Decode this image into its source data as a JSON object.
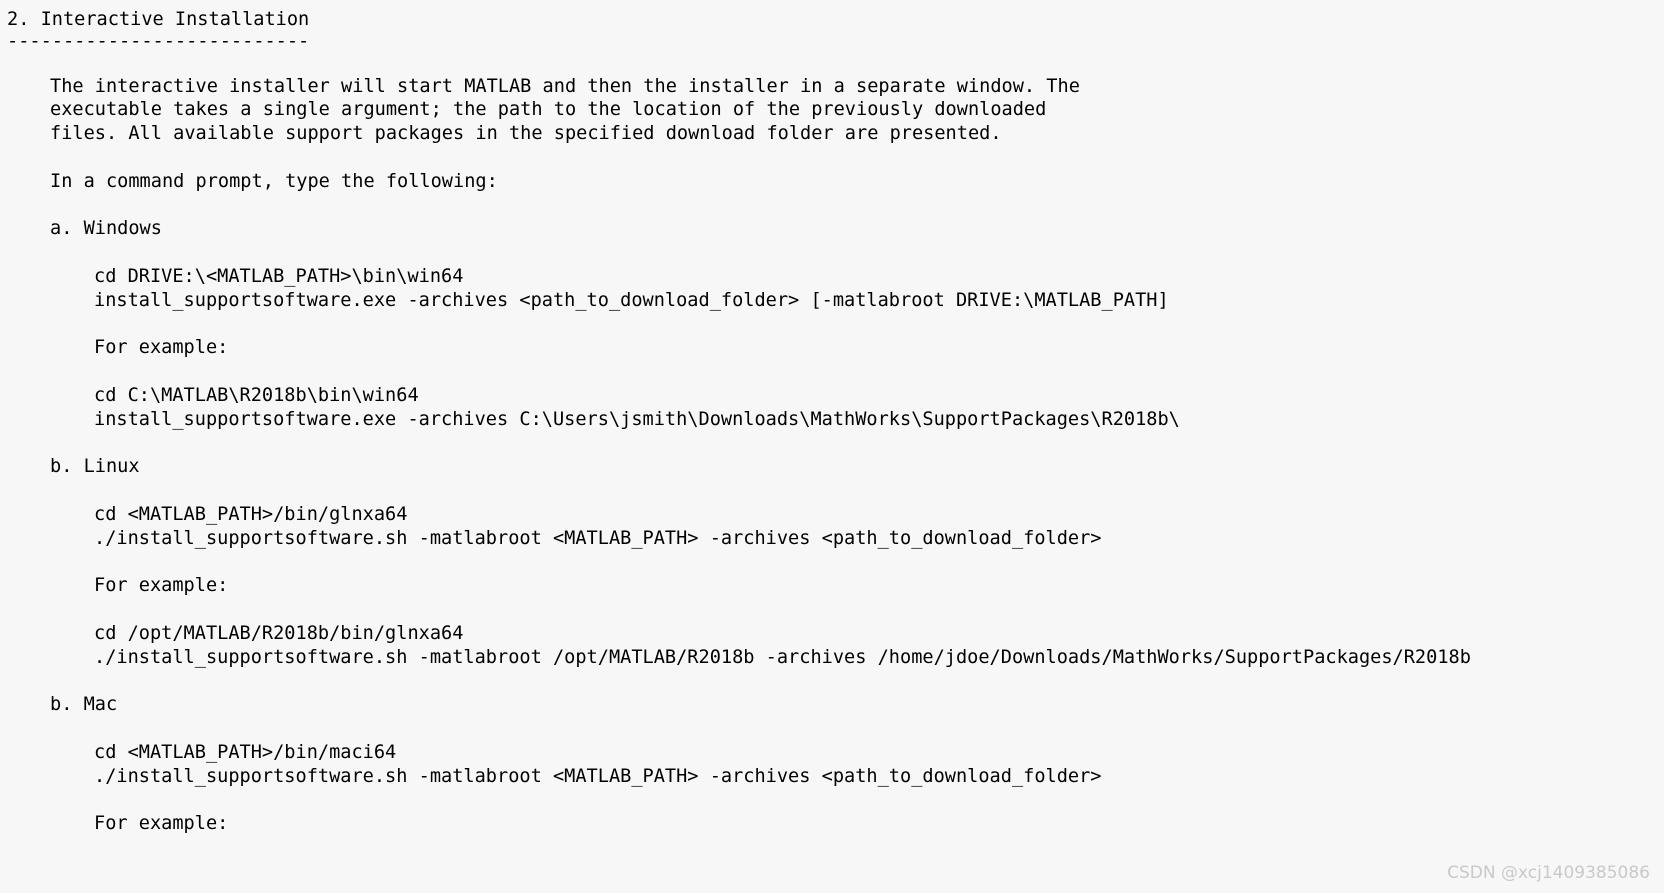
{
  "document": {
    "heading": "2. Interactive Installation",
    "heading_rule": "---------------------------",
    "paragraph_intro": [
      "The interactive installer will start MATLAB and then the installer in a separate window. The",
      "executable takes a single argument; the path to the location of the previously downloaded",
      "files. All available support packages in the specified download folder are presented."
    ],
    "prompt_line": "In a command prompt, type the following:",
    "sections": [
      {
        "label": "a. Windows",
        "commands": [
          "cd DRIVE:\\<MATLAB_PATH>\\bin\\win64",
          "install_supportsoftware.exe -archives <path_to_download_folder> [-matlabroot DRIVE:\\MATLAB_PATH]"
        ],
        "example_label": "For example:",
        "example_commands": [
          "cd C:\\MATLAB\\R2018b\\bin\\win64",
          "install_supportsoftware.exe -archives C:\\Users\\jsmith\\Downloads\\MathWorks\\SupportPackages\\R2018b\\"
        ]
      },
      {
        "label": "b. Linux",
        "commands": [
          "cd <MATLAB_PATH>/bin/glnxa64",
          "./install_supportsoftware.sh -matlabroot <MATLAB_PATH> -archives <path_to_download_folder>"
        ],
        "example_label": "For example:",
        "example_commands": [
          "cd /opt/MATLAB/R2018b/bin/glnxa64",
          "./install_supportsoftware.sh -matlabroot /opt/MATLAB/R2018b -archives /home/jdoe/Downloads/MathWorks/SupportPackages/R2018b"
        ]
      },
      {
        "label": "b. Mac",
        "commands": [
          "cd <MATLAB_PATH>/bin/maci64",
          "./install_supportsoftware.sh -matlabroot <MATLAB_PATH> -archives <path_to_download_folder>"
        ],
        "example_label": "For example:",
        "example_commands": []
      }
    ]
  },
  "watermark": {
    "text": "CSDN @xcj1409385086"
  }
}
